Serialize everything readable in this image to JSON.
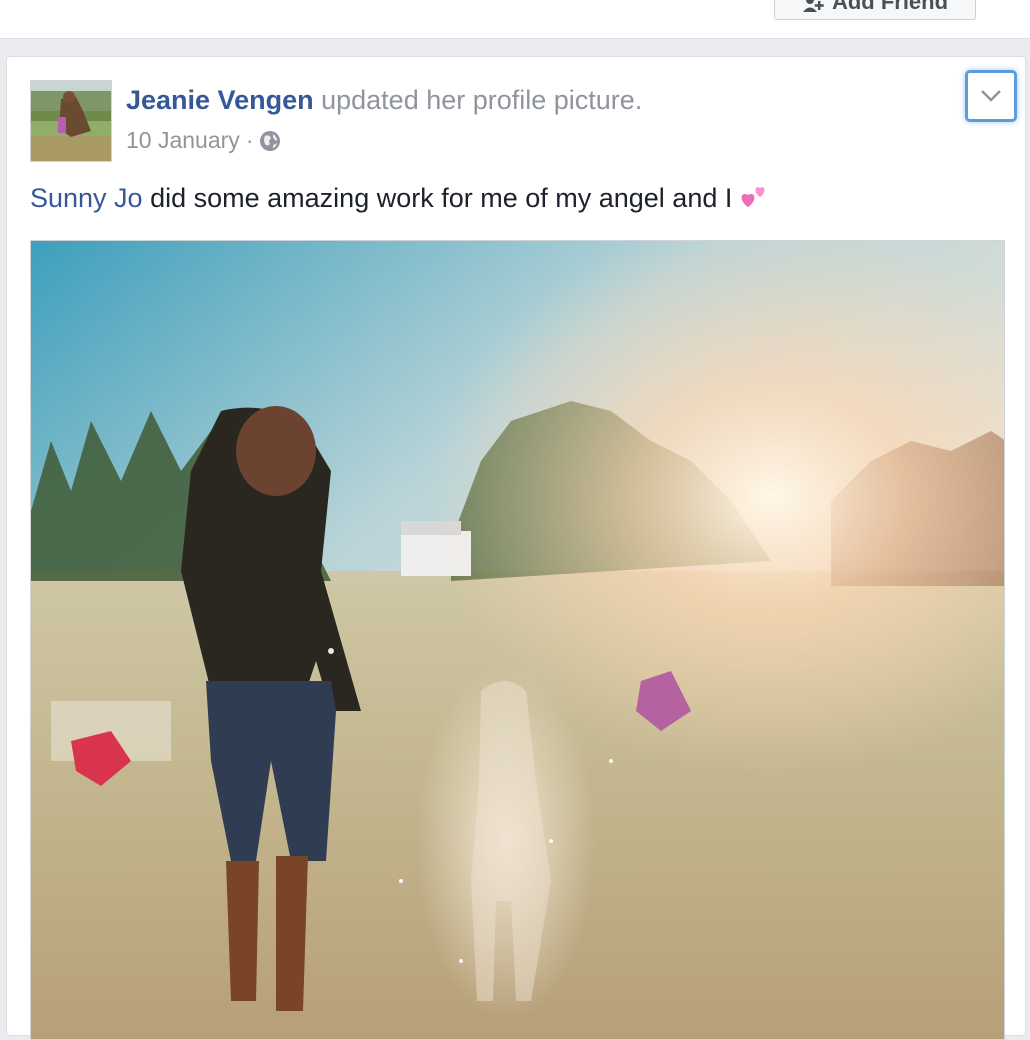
{
  "header": {
    "add_friend_label": "Add Friend"
  },
  "post": {
    "author_name": "Jeanie Vengen",
    "action_text": "updated her profile picture.",
    "date": "10 January",
    "separator": "·",
    "privacy_icon": "globe-icon",
    "menu_icon": "chevron-down-icon",
    "caption_mention": "Sunny Jo",
    "caption_text": "did some amazing work for me of my angel and I",
    "caption_emoji_icon": "two-hearts-icon"
  },
  "colors": {
    "link_blue": "#365899",
    "meta_gray": "#90949c",
    "focus_blue": "#5b9dd9"
  }
}
